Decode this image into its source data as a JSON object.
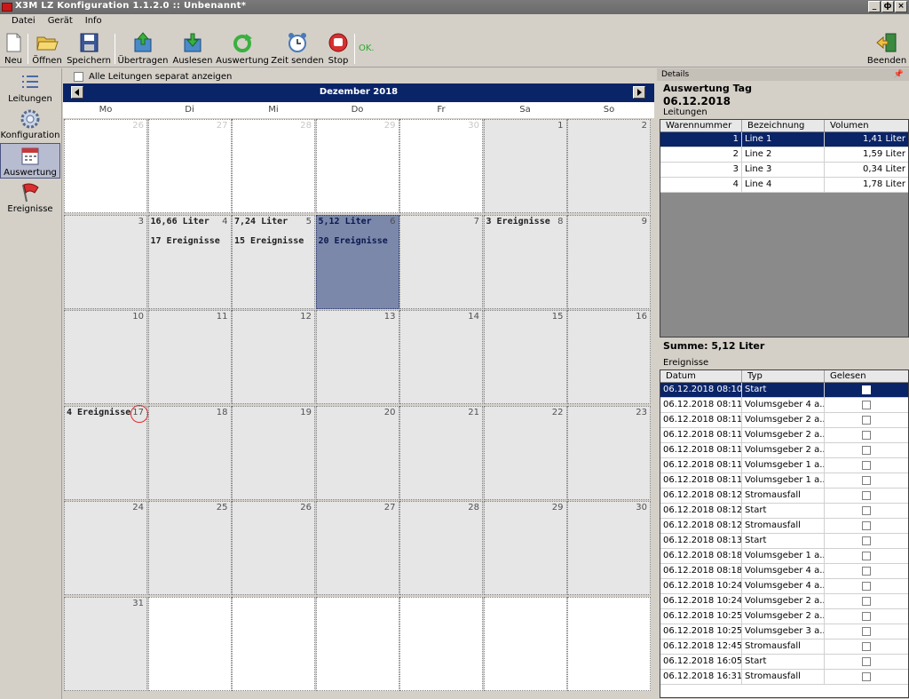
{
  "window": {
    "title": "X3M LZ Konfiguration 1.1.2.0  ::  Unbenannt*",
    "controls": [
      "_",
      "ф",
      "×"
    ]
  },
  "menu": [
    "Datei",
    "Gerät",
    "Info"
  ],
  "toolbar": {
    "buttons": [
      {
        "label": "Neu",
        "icon": "new-document-icon"
      },
      {
        "label": "Öffnen",
        "icon": "folder-open-icon"
      },
      {
        "label": "Speichern",
        "icon": "floppy-disk-icon"
      },
      {
        "label": "Übertragen",
        "icon": "upload-icon"
      },
      {
        "label": "Auslesen",
        "icon": "download-icon"
      },
      {
        "label": "Auswertung",
        "icon": "refresh-icon"
      },
      {
        "label": "Zeit senden",
        "icon": "alarm-clock-icon"
      },
      {
        "label": "Stop",
        "icon": "stop-hand-icon"
      }
    ],
    "status": "OK.",
    "exit_label": "Beenden"
  },
  "nav": [
    {
      "label": "Leitungen",
      "icon": "list-icon",
      "active": false
    },
    {
      "label": "Konfiguration",
      "icon": "gear-icon",
      "active": false
    },
    {
      "label": "Auswertung",
      "icon": "calendar-icon",
      "active": true
    },
    {
      "label": "Ereignisse",
      "icon": "flag-icon",
      "active": false
    }
  ],
  "calendar": {
    "show_all_label": "Alle Leitungen separat anzeigen",
    "month": "Dezember 2018",
    "weekdays": [
      "Mo",
      "Di",
      "Mi",
      "Do",
      "Fr",
      "Sa",
      "So"
    ],
    "weeks": [
      [
        {
          "d": "26",
          "other": true
        },
        {
          "d": "27",
          "other": true
        },
        {
          "d": "28",
          "other": true
        },
        {
          "d": "29",
          "other": true
        },
        {
          "d": "30",
          "other": true
        },
        {
          "d": "1"
        },
        {
          "d": "2"
        }
      ],
      [
        {
          "d": "3"
        },
        {
          "d": "4",
          "vol": "16,66 Liter",
          "ev": "17 Ereignisse"
        },
        {
          "d": "5",
          "vol": "7,24 Liter",
          "ev": "15 Ereignisse"
        },
        {
          "d": "6",
          "vol": "5,12 Liter",
          "ev": "20 Ereignisse",
          "selected": true
        },
        {
          "d": "7"
        },
        {
          "d": "8",
          "evtop": "3 Ereignisse"
        },
        {
          "d": "9"
        }
      ],
      [
        {
          "d": "10"
        },
        {
          "d": "11"
        },
        {
          "d": "12"
        },
        {
          "d": "13"
        },
        {
          "d": "14"
        },
        {
          "d": "15"
        },
        {
          "d": "16"
        }
      ],
      [
        {
          "d": "17",
          "evtop": "4 Ereignisse",
          "circled": true
        },
        {
          "d": "18"
        },
        {
          "d": "19"
        },
        {
          "d": "20"
        },
        {
          "d": "21"
        },
        {
          "d": "22"
        },
        {
          "d": "23"
        }
      ],
      [
        {
          "d": "24"
        },
        {
          "d": "25"
        },
        {
          "d": "26"
        },
        {
          "d": "27"
        },
        {
          "d": "28"
        },
        {
          "d": "29"
        },
        {
          "d": "30"
        }
      ],
      [
        {
          "d": "31"
        },
        {
          "d": "",
          "other": true
        },
        {
          "d": "",
          "other": true
        },
        {
          "d": "",
          "other": true
        },
        {
          "d": "",
          "other": true
        },
        {
          "d": "",
          "other": true
        },
        {
          "d": "",
          "other": true
        }
      ]
    ]
  },
  "details": {
    "panel_title": "Details",
    "heading": "Auswertung Tag",
    "date": "06.12.2018",
    "lines_label": "Leitungen",
    "lines_columns": [
      "Warennummer",
      "Bezeichnung",
      "Volumen"
    ],
    "lines": [
      {
        "nr": "1",
        "name": "Line 1",
        "vol": "1,41 Liter",
        "selected": true
      },
      {
        "nr": "2",
        "name": "Line 2",
        "vol": "1,59 Liter"
      },
      {
        "nr": "3",
        "name": "Line 3",
        "vol": "0,34 Liter"
      },
      {
        "nr": "4",
        "name": "Line 4",
        "vol": "1,78 Liter"
      }
    ],
    "sum": "Summe: 5,12 Liter",
    "events_label": "Ereignisse",
    "events_columns": [
      "Datum",
      "Typ",
      "Gelesen"
    ],
    "events": [
      {
        "date": "06.12.2018 08:10",
        "type": "Start",
        "selected": true
      },
      {
        "date": "06.12.2018 08:11",
        "type": "Volumsgeber 4 a..."
      },
      {
        "date": "06.12.2018 08:11",
        "type": "Volumsgeber 2 a..."
      },
      {
        "date": "06.12.2018 08:11",
        "type": "Volumsgeber 2 a..."
      },
      {
        "date": "06.12.2018 08:11",
        "type": "Volumsgeber 2 a..."
      },
      {
        "date": "06.12.2018 08:11",
        "type": "Volumsgeber 1 a..."
      },
      {
        "date": "06.12.2018 08:11",
        "type": "Volumsgeber 1 a..."
      },
      {
        "date": "06.12.2018 08:12",
        "type": "Stromausfall"
      },
      {
        "date": "06.12.2018 08:12",
        "type": "Start"
      },
      {
        "date": "06.12.2018 08:12",
        "type": "Stromausfall"
      },
      {
        "date": "06.12.2018 08:13",
        "type": "Start"
      },
      {
        "date": "06.12.2018 08:18",
        "type": "Volumsgeber 1 a..."
      },
      {
        "date": "06.12.2018 08:18",
        "type": "Volumsgeber 4 a..."
      },
      {
        "date": "06.12.2018 10:24",
        "type": "Volumsgeber 4 a..."
      },
      {
        "date": "06.12.2018 10:24",
        "type": "Volumsgeber 2 a..."
      },
      {
        "date": "06.12.2018 10:25",
        "type": "Volumsgeber 2 a..."
      },
      {
        "date": "06.12.2018 10:25",
        "type": "Volumsgeber 3 a..."
      },
      {
        "date": "06.12.2018 12:45",
        "type": "Stromausfall"
      },
      {
        "date": "06.12.2018 16:05",
        "type": "Start"
      },
      {
        "date": "06.12.2018 16:31",
        "type": "Stromausfall"
      }
    ]
  },
  "colors": {
    "accent": "#0a2468",
    "selected_day": "#7c88aa",
    "ok": "#2ea82e"
  }
}
